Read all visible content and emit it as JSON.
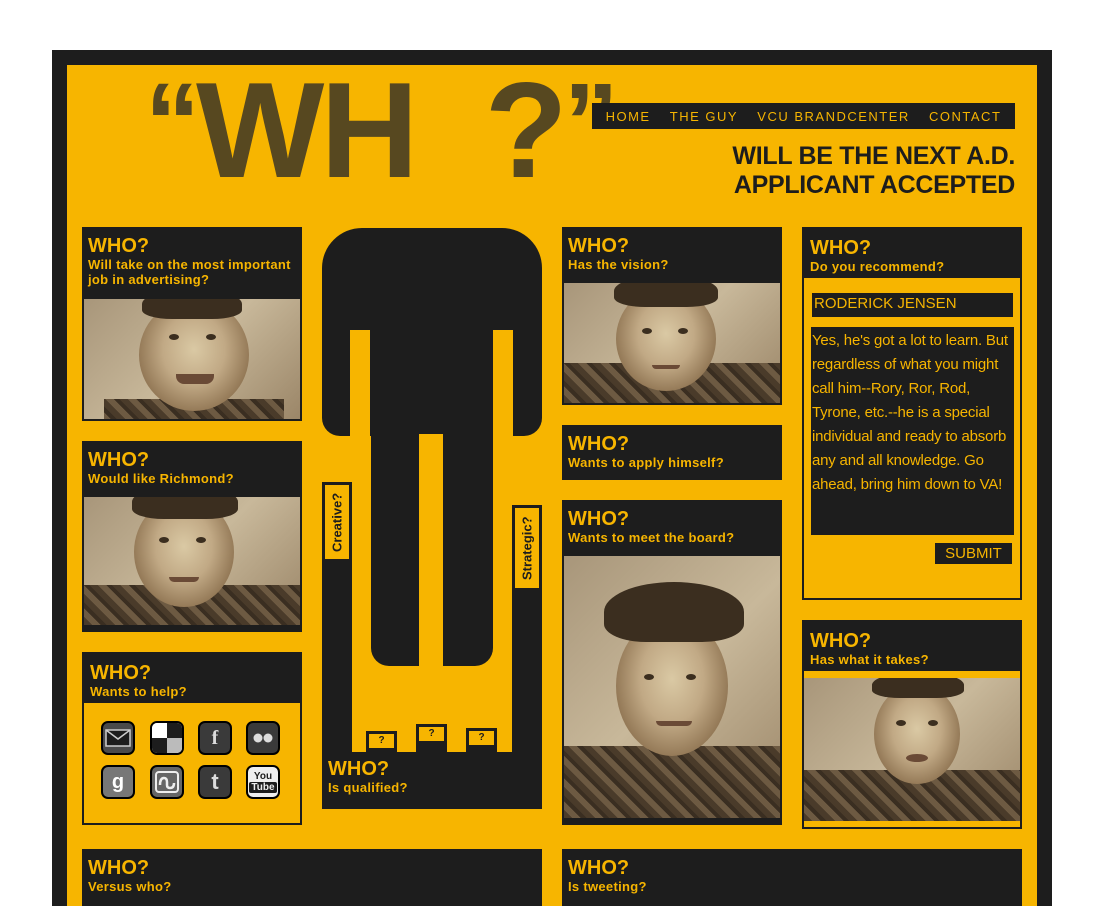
{
  "logo": {
    "open_quote": "“",
    "text_left": "WH",
    "text_right": "?",
    "close_quote": "”"
  },
  "nav": {
    "items": [
      "HOME",
      "THE GUY",
      "VCU BRANDCENTER",
      "CONTACT"
    ]
  },
  "tagline": {
    "line1": "WILL BE THE NEXT A.D.",
    "line2": "APPLICANT ACCEPTED"
  },
  "panels": {
    "advertising": {
      "who": "WHO?",
      "question": "Will take on the most important job in advertising?"
    },
    "richmond": {
      "who": "WHO?",
      "question": "Would like Richmond?"
    },
    "help": {
      "who": "WHO?",
      "question": "Wants to help?"
    },
    "vision": {
      "who": "WHO?",
      "question": "Has the vision?"
    },
    "apply": {
      "who": "WHO?",
      "question": "Wants to apply himself?"
    },
    "board": {
      "who": "WHO?",
      "question": "Wants to meet the board?"
    },
    "recommend": {
      "who": "WHO?",
      "question": "Do you recommend?"
    },
    "takes": {
      "who": "WHO?",
      "question": "Has what it takes?"
    },
    "qualified": {
      "who": "WHO?",
      "question": "Is qualified?"
    },
    "versus": {
      "who": "WHO?",
      "question": "Versus who?"
    },
    "tweeting": {
      "who": "WHO?",
      "question": "Is tweeting?"
    }
  },
  "figure": {
    "left_label": "Creative?",
    "right_label": "Strategic?",
    "bar_labels": [
      "?",
      "?",
      "?"
    ],
    "bar_levels": [
      0.27,
      0.36,
      0.31
    ]
  },
  "form": {
    "name_value": "RODERICK JENSEN",
    "message_value": "Yes, he's got a lot to learn. But regardless of what you might call him--Rory, Ror, Rod, Tyrone, etc.--he is a special individual and ready to absorb any and all knowledge. Go ahead, bring him down to VA!",
    "submit_label": "SUBMIT"
  },
  "social_icons": [
    "email-icon",
    "delicious-icon",
    "facebook-icon",
    "flickr-icon",
    "google-icon",
    "stumbleupon-icon",
    "twitter-icon",
    "youtube-icon"
  ],
  "social_glyphs": {
    "youtube_top": "You",
    "youtube_bottom": "Tube"
  },
  "colors": {
    "accent": "#f7b500",
    "dark": "#1d1d1d",
    "logo": "#574820"
  }
}
